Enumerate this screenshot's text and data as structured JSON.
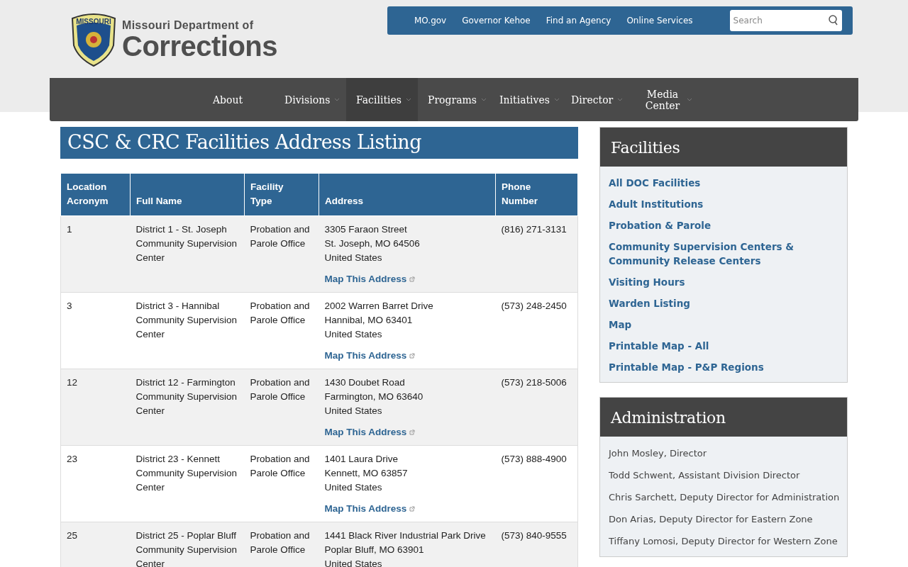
{
  "logo": {
    "badge_text": "MISSOURI",
    "line_1": "Missouri Department of",
    "line_2": "Corrections"
  },
  "top_links": [
    "MO.gov",
    "Governor Kehoe",
    "Find an Agency",
    "Online Services"
  ],
  "search": {
    "placeholder": "Search"
  },
  "nav": [
    {
      "label": "About",
      "dropdown": false,
      "selected": false
    },
    {
      "label": "Divisions",
      "dropdown": true,
      "selected": false
    },
    {
      "label": "Facilities",
      "dropdown": true,
      "selected": true
    },
    {
      "label": "Programs",
      "dropdown": true,
      "selected": false
    },
    {
      "label": "Initiatives",
      "dropdown": true,
      "selected": false
    },
    {
      "label": "Director",
      "dropdown": true,
      "selected": false
    },
    {
      "label": "Media Center",
      "dropdown": true,
      "selected": false
    }
  ],
  "page_title": "CSC & CRC Facilities Address Listing",
  "table": {
    "columns": [
      "Location Acronym",
      "Full Name",
      "Facility Type",
      "Address",
      "Phone Number"
    ],
    "rows": [
      {
        "acronym": "1",
        "name": "District 1 - St. Joseph Community Supervision Center",
        "type": "Probation and Parole Office",
        "address": [
          "3305 Faraon Street",
          "St. Joseph, MO 64506",
          "United States"
        ],
        "map_link": "Map This Address",
        "phone": "(816) 271-3131"
      },
      {
        "acronym": "3",
        "name": "District 3 - Hannibal Community Supervision Center",
        "type": "Probation and Parole Office",
        "address": [
          "2002 Warren Barret Drive",
          "Hannibal, MO 63401",
          "United States"
        ],
        "map_link": "Map This Address",
        "phone": "(573) 248-2450"
      },
      {
        "acronym": "12",
        "name": "District 12 - Farmington Community Supervision Center",
        "type": "Probation and Parole Office",
        "address": [
          "1430 Doubet Road",
          "Farmington, MO 63640",
          "United States"
        ],
        "map_link": "Map This Address",
        "phone": "(573) 218-5006"
      },
      {
        "acronym": "23",
        "name": "District 23 - Kennett Community Supervision Center",
        "type": "Probation and Parole Office",
        "address": [
          "1401 Laura Drive",
          "Kennett, MO 63857",
          "United States"
        ],
        "map_link": "Map This Address",
        "phone": "(573) 888-4900"
      },
      {
        "acronym": "25",
        "name": "District 25 - Poplar Bluff Community Supervision Center",
        "type": "Probation and Parole Office",
        "address": [
          "1441 Black River Industrial Park Drive",
          "Poplar Bluff, MO 63901",
          "United States"
        ],
        "phone": "(573) 840-9555"
      }
    ]
  },
  "sidebar": [
    {
      "title": "Facilities",
      "kind": "links",
      "items": [
        "All DOC Facilities",
        "Adult Institutions",
        "Probation & Parole",
        "Community Supervision Centers & Community Release Centers",
        "Visiting Hours",
        "Warden Listing",
        "Map",
        "Printable Map - All",
        "Printable Map - P&P Regions"
      ]
    },
    {
      "title": "Administration",
      "kind": "text",
      "items": [
        "John Mosley, Director",
        "Todd Schwent, Assistant Division Director",
        "Chris Sarchett, Deputy Director for Administration",
        "Don Arias, Deputy Director for Eastern Zone",
        "Tiffany Lomosi, Deputy Director for Western Zone"
      ]
    }
  ]
}
